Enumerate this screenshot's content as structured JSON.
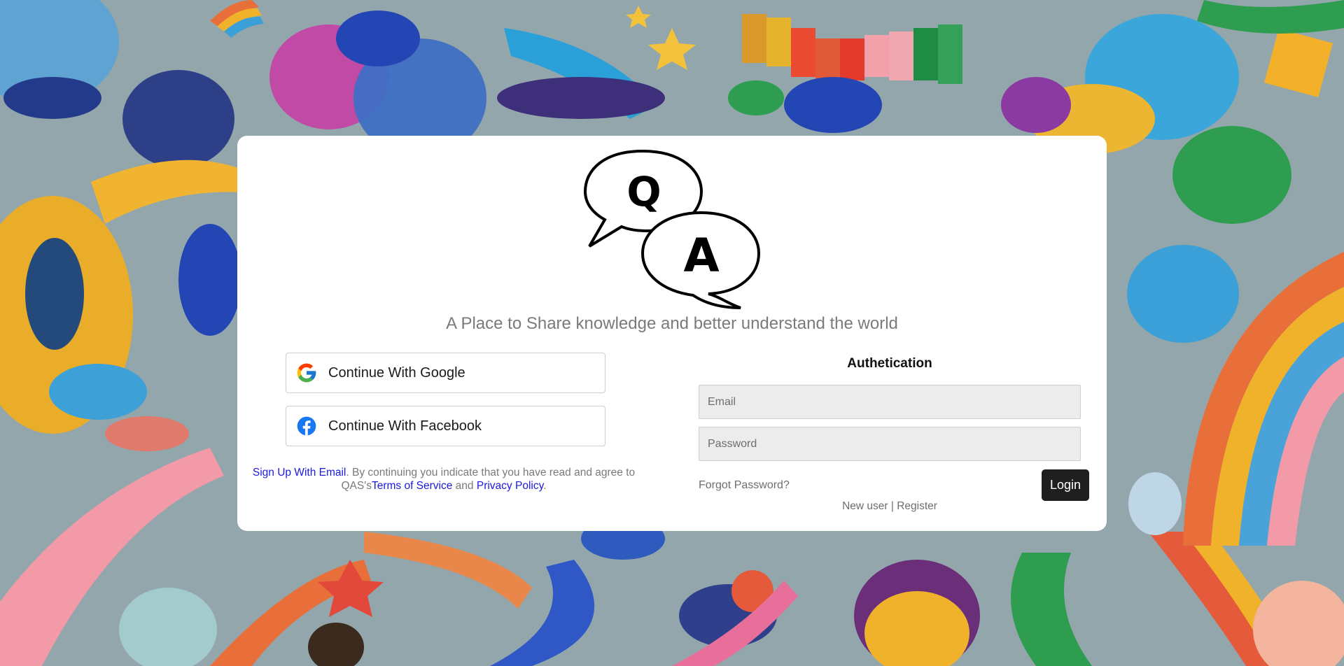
{
  "background": {
    "color": "#8fa3a8",
    "style": "illustrated crowd of floating people and rainbows"
  },
  "logo": {
    "letter_q": "Q",
    "letter_a": "A"
  },
  "tagline": "A Place to Share knowledge and better understand the world",
  "social": {
    "google_label": "Continue With Google",
    "facebook_label": "Continue With Facebook",
    "google_icon": "google-g-icon",
    "facebook_icon": "facebook-f-icon"
  },
  "legal": {
    "signup_link": "Sign Up With Email",
    "text_1": ". By continuing you indicate that you have read and agree to QAS's",
    "terms_link": "Terms of Service",
    "text_2": " and ",
    "privacy_link": "Privacy Policy",
    "text_3": "."
  },
  "auth": {
    "title": "Authetication",
    "email_placeholder": "Email",
    "password_placeholder": "Password",
    "forgot_label": "Forgot Password?",
    "login_label": "Login",
    "new_user_label": "New user",
    "separator": " | ",
    "register_label": "Register"
  },
  "colors": {
    "card": "#ffffff",
    "link": "#1a1adf",
    "login_button": "#1f1f1f",
    "input_bg": "#ececec"
  }
}
